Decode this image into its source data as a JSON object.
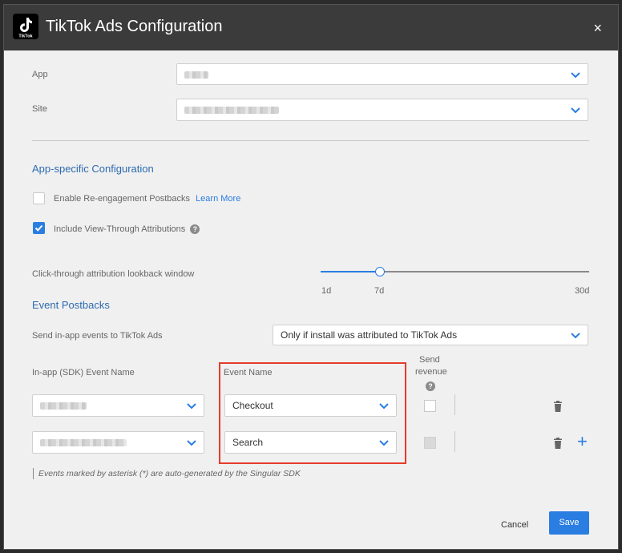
{
  "header": {
    "title": "TikTok Ads Configuration",
    "close_label": "×",
    "logo_text": "TikTok"
  },
  "app": {
    "label": "App"
  },
  "site": {
    "label": "Site"
  },
  "app_config": {
    "title": "App-specific Configuration",
    "reengagement": {
      "label": "Enable Re-engagement Postbacks",
      "link": "Learn More",
      "checked": false
    },
    "view_through": {
      "label": "Include View-Through Attributions",
      "checked": true
    }
  },
  "lookback": {
    "label": "Click-through attribution lookback window",
    "ticks": [
      "1d",
      "7d",
      "30d"
    ],
    "selected": "7d",
    "fraction": 0.22
  },
  "event_postbacks": {
    "title": "Event Postbacks",
    "send_label": "Send in-app events to TikTok Ads",
    "send_value": "Only if install was attributed to TikTok Ads",
    "col_sdk": "In-app (SDK) Event Name",
    "col_event": "Event Name",
    "col_revenue_1": "Send",
    "col_revenue_2": "revenue",
    "rows": [
      {
        "event_name": "Checkout",
        "send_revenue": false,
        "revenue_enabled": true
      },
      {
        "event_name": "Search",
        "send_revenue": false,
        "revenue_enabled": false
      }
    ],
    "note": "Events marked by asterisk (*) are auto-generated by the Singular SDK"
  },
  "footer": {
    "cancel": "Cancel",
    "save": "Save"
  },
  "colors": {
    "accent": "#2a7de1",
    "highlight": "#e53b2c",
    "header": "#3b3b3b"
  },
  "icons": [
    "tiktok-logo-icon",
    "close-icon",
    "chevron-down-icon",
    "checkmark-icon",
    "help-icon",
    "trash-icon",
    "plus-icon"
  ]
}
